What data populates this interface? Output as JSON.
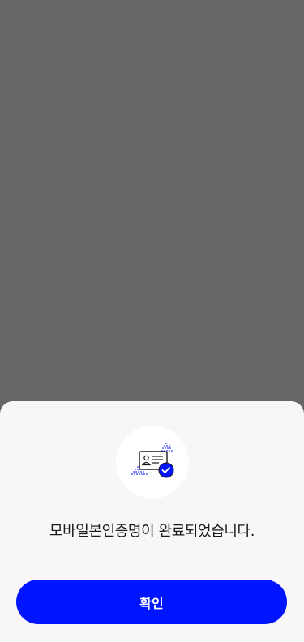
{
  "modal": {
    "icon": "id-card-verified-icon",
    "message": "모바일본인증명이 완료되었습니다.",
    "confirm_label": "확인"
  },
  "colors": {
    "backdrop": "#666666",
    "sheet": "#f8f6f6",
    "primary": "#0015ff",
    "text": "#1a1a1a"
  }
}
